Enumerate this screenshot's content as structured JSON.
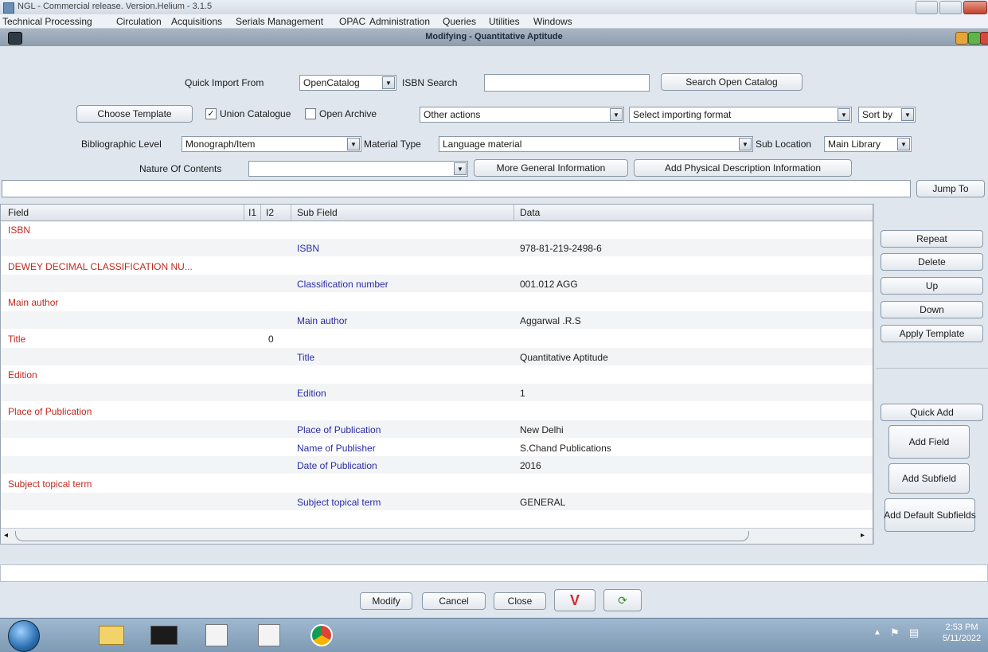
{
  "os_window": {
    "title": "NGL - Commercial release. Version.Helium - 3.1.5"
  },
  "menubar": [
    "Technical Processing",
    "Circulation",
    "Acquisitions",
    "Serials Management",
    "OPAC",
    "Administration",
    "Queries",
    "Utilities",
    "Windows"
  ],
  "inner_window": {
    "title": "Modifying - Quantitative Aptitude"
  },
  "form": {
    "quick_import_label": "Quick Import From",
    "quick_import_value": "OpenCatalog",
    "isbn_search_label": "ISBN Search",
    "isbn_search_value": "",
    "search_open_catalog": "Search Open Catalog",
    "choose_template": "Choose Template",
    "union_catalogue_label": "Union Catalogue",
    "union_catalogue_checked": true,
    "open_archive_label": "Open Archive",
    "open_archive_checked": false,
    "other_actions": "Other actions",
    "import_format": "Select importing format",
    "sort_by": "Sort by",
    "bib_level_label": "Bibliographic Level",
    "bib_level_value": "Monograph/Item",
    "material_type_label": "Material Type",
    "material_type_value": "Language material",
    "sub_location_label": "Sub Location",
    "sub_location_value": "Main Library",
    "nature_contents_label": "Nature Of Contents",
    "nature_contents_value": "",
    "more_general": "More General Information",
    "add_physical": "Add Physical Description Information",
    "jump_to": "Jump To",
    "jump_value": ""
  },
  "table": {
    "headers": {
      "field": "Field",
      "i1": "I1",
      "i2": "I2",
      "subfield": "Sub Field",
      "data": "Data"
    },
    "rows": [
      {
        "field": "ISBN",
        "i1": "",
        "subfield": "",
        "data": ""
      },
      {
        "field": "",
        "i1": "",
        "subfield": "ISBN",
        "data": "978-81-219-2498-6"
      },
      {
        "field": "DEWEY DECIMAL CLASSIFICATION NU...",
        "i1": "",
        "subfield": "",
        "data": ""
      },
      {
        "field": "",
        "i1": "",
        "subfield": "Classification number",
        "data": "001.012 AGG"
      },
      {
        "field": "Main author",
        "i1": "",
        "subfield": "",
        "data": ""
      },
      {
        "field": "",
        "i1": "",
        "subfield": "Main author",
        "data": "Aggarwal .R.S"
      },
      {
        "field": "Title",
        "i1": "0",
        "subfield": "",
        "data": ""
      },
      {
        "field": "",
        "i1": "",
        "subfield": "Title",
        "data": "Quantitative Aptitude"
      },
      {
        "field": "Edition",
        "i1": "",
        "subfield": "",
        "data": ""
      },
      {
        "field": "",
        "i1": "",
        "subfield": "Edition",
        "data": "1"
      },
      {
        "field": "Place of Publication",
        "i1": "",
        "subfield": "",
        "data": ""
      },
      {
        "field": "",
        "i1": "",
        "subfield": "Place of Publication",
        "data": "New Delhi"
      },
      {
        "field": "",
        "i1": "",
        "subfield": "Name of Publisher",
        "data": "S.Chand Publications"
      },
      {
        "field": "",
        "i1": "",
        "subfield": "Date of Publication",
        "data": "2016"
      },
      {
        "field": "Subject topical term",
        "i1": "",
        "subfield": "",
        "data": ""
      },
      {
        "field": "",
        "i1": "",
        "subfield": "Subject topical term",
        "data": "GENERAL"
      }
    ]
  },
  "side_buttons": {
    "repeat": "Repeat",
    "delete": "Delete",
    "up": "Up",
    "down": "Down",
    "apply_template": "Apply Template",
    "quick_add": "Quick Add",
    "add_field": "Add Field",
    "add_subfield": "Add Subfield",
    "add_default_subfields": "Add Default Subfields"
  },
  "bottom_buttons": {
    "modify": "Modify",
    "cancel": "Cancel",
    "close": "Close"
  },
  "taskbar": {
    "time": "2:53 PM",
    "date": "5/11/2022"
  },
  "colors": {
    "field_red": "#c0291f",
    "subfield_blue": "#2a2ba3",
    "validate_red": "#d42a2a"
  },
  "icons": [
    "windows-start-icon",
    "file-explorer-icon",
    "terminal-icon",
    "java-icon",
    "java-icon",
    "chrome-icon",
    "flag-icon",
    "network-icon"
  ]
}
